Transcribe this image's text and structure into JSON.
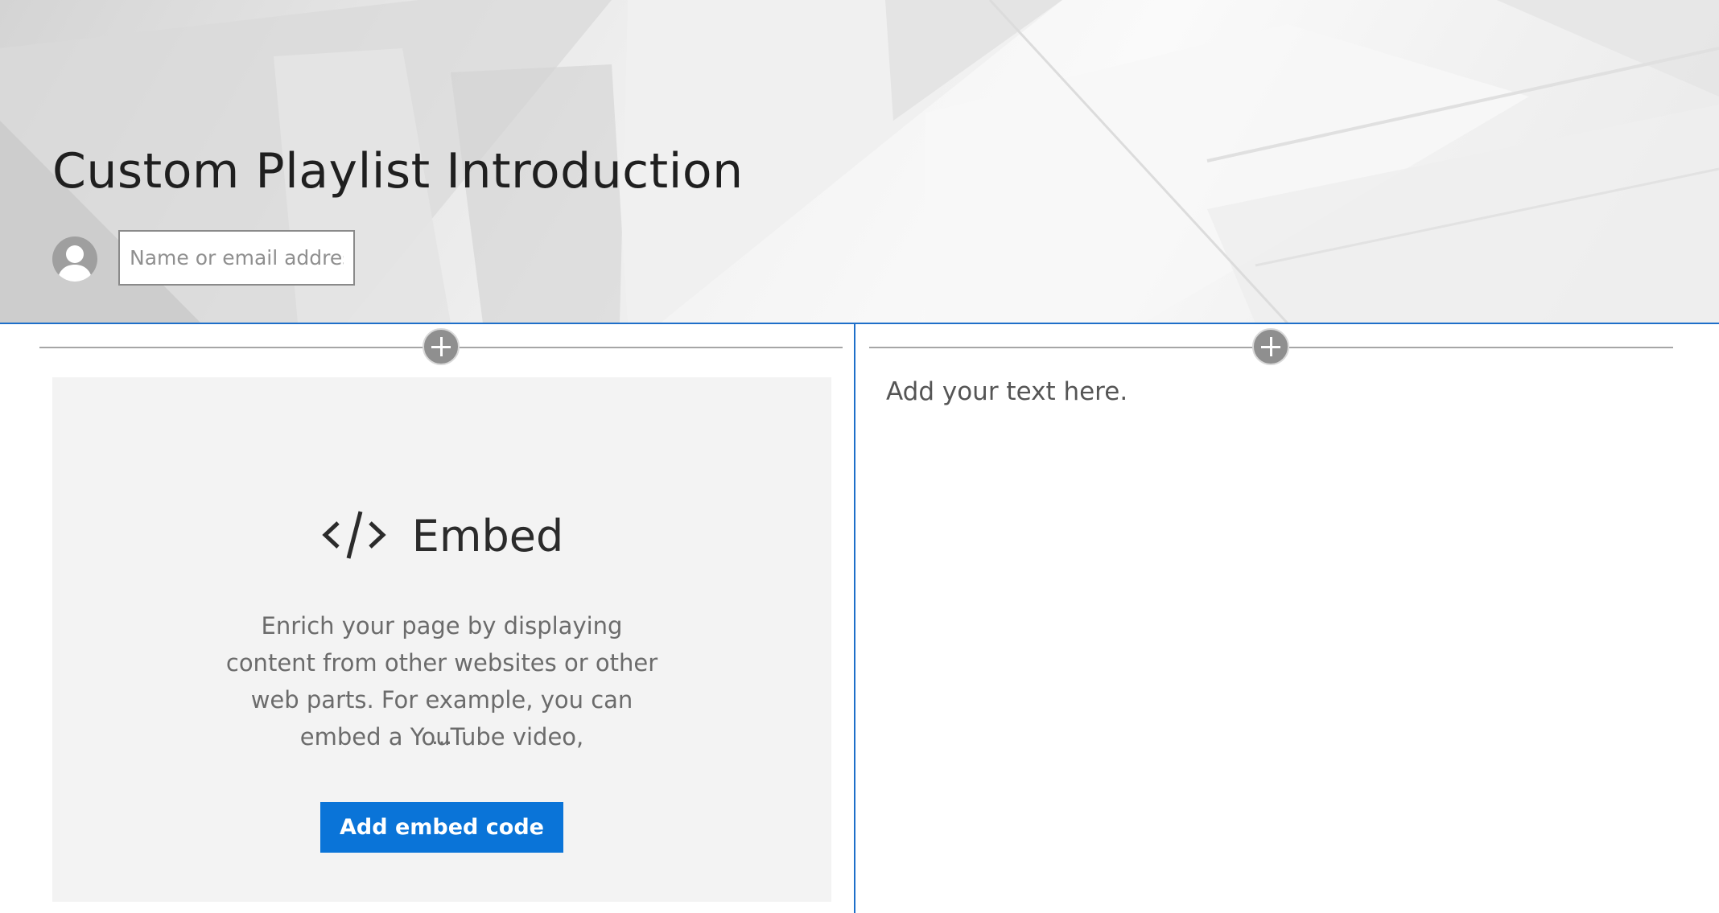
{
  "header": {
    "title": "Custom Playlist Introduction",
    "author_placeholder": "Name or email address"
  },
  "embed": {
    "title": "Embed",
    "description": "Enrich your page by displaying content from other websites or other web parts. For example, you can embed a YouTube video,",
    "ellipsis": "...",
    "button_label": "Add embed code"
  },
  "text_part": {
    "placeholder": "Add your text here."
  },
  "colors": {
    "accent": "#0a74d8",
    "section_border": "#1e6fc9",
    "card_background": "#f3f3f3"
  },
  "icons": {
    "avatar": "person-icon",
    "embed": "code-brackets-icon",
    "add_section": "plus-circle-icon"
  }
}
